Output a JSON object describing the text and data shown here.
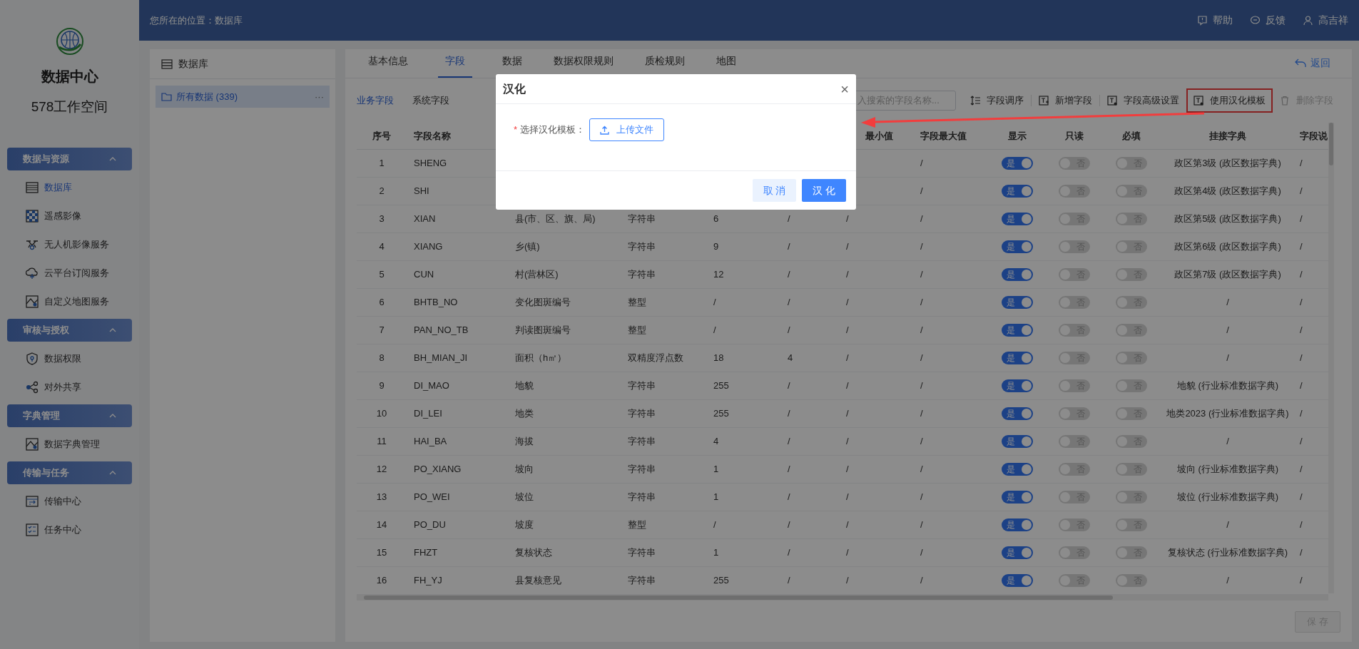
{
  "header": {
    "breadcrumb": "您所在的位置：数据库",
    "actions": [
      {
        "label": "帮助"
      },
      {
        "label": "反馈"
      },
      {
        "label": "高吉祥"
      }
    ]
  },
  "sidebar": {
    "title": "数据中心",
    "subtitle": "578工作空间",
    "groups": [
      {
        "title": "数据与资源",
        "expanded": true,
        "items": [
          {
            "label": "数据库",
            "selected": true
          },
          {
            "label": "遥感影像",
            "selected": false
          },
          {
            "label": "无人机影像服务",
            "selected": false
          },
          {
            "label": "云平台订阅服务",
            "selected": false
          },
          {
            "label": "自定义地图服务",
            "selected": false
          }
        ]
      },
      {
        "title": "审核与授权",
        "expanded": true,
        "items": [
          {
            "label": "数据权限",
            "selected": false
          },
          {
            "label": "对外共享",
            "selected": false
          }
        ]
      },
      {
        "title": "字典管理",
        "expanded": true,
        "items": [
          {
            "label": "数据字典管理",
            "selected": false
          }
        ]
      },
      {
        "title": "传输与任务",
        "expanded": true,
        "items": [
          {
            "label": "传输中心",
            "selected": false
          },
          {
            "label": "任务中心",
            "selected": false
          }
        ]
      }
    ]
  },
  "tree_panel": {
    "title": "数据库",
    "items": [
      {
        "label": "所有数据 (339)",
        "more": "···",
        "selected": true
      }
    ]
  },
  "tabs": [
    {
      "label": "基本信息",
      "selected": false
    },
    {
      "label": "字段",
      "selected": true
    },
    {
      "label": "数据",
      "selected": false
    },
    {
      "label": "数据权限规则",
      "selected": false
    },
    {
      "label": "质检规则",
      "selected": false
    },
    {
      "label": "地图",
      "selected": false
    }
  ],
  "back_link": "返回",
  "sub_tabs": [
    {
      "label": "业务字段",
      "selected": true
    },
    {
      "label": "系统字段",
      "selected": false
    }
  ],
  "search": {
    "placeholder": "入搜索的字段名称..."
  },
  "toolbar": [
    {
      "label": "字段调序",
      "disabled": false,
      "highlighted": false
    },
    {
      "label": "新增字段",
      "disabled": false,
      "highlighted": false
    },
    {
      "label": "字段高级设置",
      "disabled": false,
      "highlighted": false
    },
    {
      "label": "使用汉化模板",
      "disabled": false,
      "highlighted": true
    },
    {
      "label": "删除字段",
      "disabled": true,
      "highlighted": false
    }
  ],
  "table": {
    "columns": [
      {
        "label": "序号",
        "kind": "text"
      },
      {
        "label": "字段名称",
        "kind": "text"
      },
      {
        "kind": "text"
      },
      {
        "kind": "text"
      },
      {
        "kind": "text"
      },
      {
        "kind": "text"
      },
      {
        "label": "最小值",
        "kind": "text"
      },
      {
        "label": "字段最大值",
        "kind": "text"
      },
      {
        "label": "显示",
        "kind": "toggle"
      },
      {
        "label": "只读",
        "kind": "toggle"
      },
      {
        "label": "必填",
        "kind": "toggle"
      },
      {
        "label": "挂接字典",
        "kind": "text"
      },
      {
        "label": "字段说",
        "kind": "text"
      }
    ],
    "rows": [
      {
        "no": "1",
        "name": "SHENG",
        "max": "/",
        "show": {
          "on": true,
          "label": "是"
        },
        "readonly": {
          "on": false,
          "label": "否"
        },
        "required": {
          "on": false,
          "label": "否"
        },
        "dict": "政区第3级 (政区数据字典)",
        "desc": "/"
      },
      {
        "no": "2",
        "name": "SHI",
        "max": "/",
        "show": {
          "on": true,
          "label": "是"
        },
        "readonly": {
          "on": false,
          "label": "否"
        },
        "required": {
          "on": false,
          "label": "否"
        },
        "dict": "政区第4级 (政区数据字典)",
        "desc": "/"
      },
      {
        "no": "3",
        "name": "XIAN",
        "column_3": "县(市、区、旗、局)",
        "column_4": "字符串",
        "column_5": "6",
        "column_6": "/",
        "min": "/",
        "max": "/",
        "show": {
          "on": true,
          "label": "是"
        },
        "readonly": {
          "on": false,
          "label": "否"
        },
        "required": {
          "on": false,
          "label": "否"
        },
        "dict": "政区第5级 (政区数据字典)",
        "desc": "/"
      },
      {
        "no": "4",
        "name": "XIANG",
        "column_3": "乡(镇)",
        "column_4": "字符串",
        "column_5": "9",
        "column_6": "/",
        "min": "/",
        "max": "/",
        "show": {
          "on": true,
          "label": "是"
        },
        "readonly": {
          "on": false,
          "label": "否"
        },
        "required": {
          "on": false,
          "label": "否"
        },
        "dict": "政区第6级 (政区数据字典)",
        "desc": "/"
      },
      {
        "no": "5",
        "name": "CUN",
        "column_3": "村(营林区)",
        "column_4": "字符串",
        "column_5": "12",
        "column_6": "/",
        "min": "/",
        "max": "/",
        "show": {
          "on": true,
          "label": "是"
        },
        "readonly": {
          "on": false,
          "label": "否"
        },
        "required": {
          "on": false,
          "label": "否"
        },
        "dict": "政区第7级 (政区数据字典)",
        "desc": "/"
      },
      {
        "no": "6",
        "name": "BHTB_NO",
        "column_3": "变化图斑编号",
        "column_4": "整型",
        "column_5": "/",
        "column_6": "/",
        "min": "/",
        "max": "/",
        "show": {
          "on": true,
          "label": "是"
        },
        "readonly": {
          "on": false,
          "label": "否"
        },
        "required": {
          "on": false,
          "label": "否"
        },
        "dict": "/",
        "desc": "/"
      },
      {
        "no": "7",
        "name": "PAN_NO_TB",
        "column_3": "判读图斑编号",
        "column_4": "整型",
        "column_5": "/",
        "column_6": "/",
        "min": "/",
        "max": "/",
        "show": {
          "on": true,
          "label": "是"
        },
        "readonly": {
          "on": false,
          "label": "否"
        },
        "required": {
          "on": false,
          "label": "否"
        },
        "dict": "/",
        "desc": "/"
      },
      {
        "no": "8",
        "name": "BH_MIAN_JI",
        "column_3": "面积（h㎡）",
        "column_4": "双精度浮点数",
        "column_5": "18",
        "column_6": "4",
        "min": "/",
        "max": "/",
        "show": {
          "on": true,
          "label": "是"
        },
        "readonly": {
          "on": false,
          "label": "否"
        },
        "required": {
          "on": false,
          "label": "否"
        },
        "dict": "/",
        "desc": "/"
      },
      {
        "no": "9",
        "name": "DI_MAO",
        "column_3": "地貌",
        "column_4": "字符串",
        "column_5": "255",
        "column_6": "/",
        "min": "/",
        "max": "/",
        "show": {
          "on": true,
          "label": "是"
        },
        "readonly": {
          "on": false,
          "label": "否"
        },
        "required": {
          "on": false,
          "label": "否"
        },
        "dict": "地貌 (行业标准数据字典)",
        "desc": "/"
      },
      {
        "no": "10",
        "name": "DI_LEI",
        "column_3": "地类",
        "column_4": "字符串",
        "column_5": "255",
        "column_6": "/",
        "min": "/",
        "max": "/",
        "show": {
          "on": true,
          "label": "是"
        },
        "readonly": {
          "on": false,
          "label": "否"
        },
        "required": {
          "on": false,
          "label": "否"
        },
        "dict": "地类2023 (行业标准数据字典)",
        "desc": "/"
      },
      {
        "no": "11",
        "name": "HAI_BA",
        "column_3": "海拔",
        "column_4": "字符串",
        "column_5": "4",
        "column_6": "/",
        "min": "/",
        "max": "/",
        "show": {
          "on": true,
          "label": "是"
        },
        "readonly": {
          "on": false,
          "label": "否"
        },
        "required": {
          "on": false,
          "label": "否"
        },
        "dict": "/",
        "desc": "/"
      },
      {
        "no": "12",
        "name": "PO_XIANG",
        "column_3": "坡向",
        "column_4": "字符串",
        "column_5": "1",
        "column_6": "/",
        "min": "/",
        "max": "/",
        "show": {
          "on": true,
          "label": "是"
        },
        "readonly": {
          "on": false,
          "label": "否"
        },
        "required": {
          "on": false,
          "label": "否"
        },
        "dict": "坡向 (行业标准数据字典)",
        "desc": "/"
      },
      {
        "no": "13",
        "name": "PO_WEI",
        "column_3": "坡位",
        "column_4": "字符串",
        "column_5": "1",
        "column_6": "/",
        "min": "/",
        "max": "/",
        "show": {
          "on": true,
          "label": "是"
        },
        "readonly": {
          "on": false,
          "label": "否"
        },
        "required": {
          "on": false,
          "label": "否"
        },
        "dict": "坡位 (行业标准数据字典)",
        "desc": "/"
      },
      {
        "no": "14",
        "name": "PO_DU",
        "column_3": "坡度",
        "column_4": "整型",
        "column_5": "/",
        "column_6": "/",
        "min": "/",
        "max": "/",
        "show": {
          "on": true,
          "label": "是"
        },
        "readonly": {
          "on": false,
          "label": "否"
        },
        "required": {
          "on": false,
          "label": "否"
        },
        "dict": "/",
        "desc": "/"
      },
      {
        "no": "15",
        "name": "FHZT",
        "column_3": "复核状态",
        "column_4": "字符串",
        "column_5": "1",
        "column_6": "/",
        "min": "/",
        "max": "/",
        "show": {
          "on": true,
          "label": "是"
        },
        "readonly": {
          "on": false,
          "label": "否"
        },
        "required": {
          "on": false,
          "label": "否"
        },
        "dict": "复核状态 (行业标准数据字典)",
        "desc": "/"
      },
      {
        "no": "16",
        "name": "FH_YJ",
        "column_3": "县复核意见",
        "column_4": "字符串",
        "column_5": "255",
        "column_6": "/",
        "min": "/",
        "max": "/",
        "show": {
          "on": true,
          "label": "是"
        },
        "readonly": {
          "on": false,
          "label": "否"
        },
        "required": {
          "on": false,
          "label": "否"
        },
        "dict": "/",
        "desc": "/"
      }
    ]
  },
  "save_button": {
    "label": "保 存",
    "disabled": true
  },
  "dialog": {
    "title": "汉化",
    "close": "×",
    "field_label": "选择汉化模板：",
    "required_mark": "*",
    "upload_button": "上传文件",
    "cancel_button": "取 消",
    "confirm_button": "汉 化"
  }
}
